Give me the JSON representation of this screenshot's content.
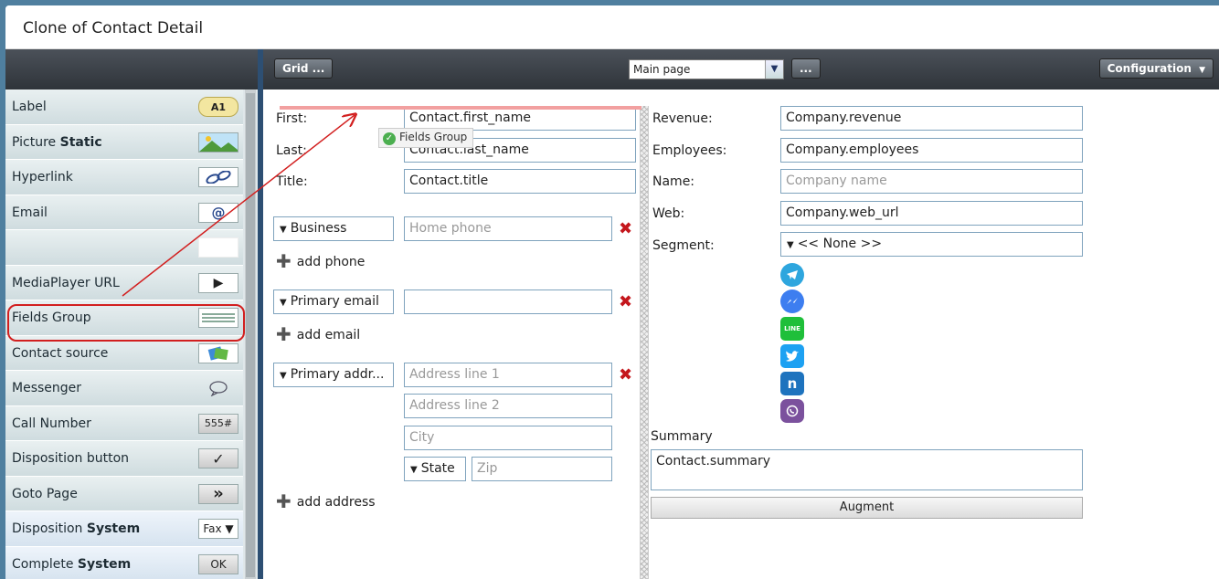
{
  "window": {
    "title": "Clone of Contact Detail"
  },
  "toolbar": {
    "grid_label": "Grid ...",
    "page_select": "Main page",
    "more_label": "...",
    "configuration_label": "Configuration"
  },
  "sidebar": {
    "items": [
      {
        "label": "Label",
        "bold": "",
        "icon": "A1"
      },
      {
        "label": "Picture ",
        "bold": "Static",
        "icon": "picture-icon"
      },
      {
        "label": "Hyperlink",
        "bold": "",
        "icon": "link-icon"
      },
      {
        "label": "Email",
        "bold": "",
        "icon": "@"
      },
      {
        "label": "",
        "bold": "",
        "icon": ""
      },
      {
        "label": "MediaPlayer URL",
        "bold": "",
        "icon": "▶"
      },
      {
        "label": "Fields Group",
        "bold": "",
        "icon": "fields-group-icon"
      },
      {
        "label": "Contact source",
        "bold": "",
        "icon": "contact-source-icon"
      },
      {
        "label": "Messenger",
        "bold": "",
        "icon": "speech-bubble-icon"
      },
      {
        "label": "Call Number",
        "bold": "",
        "icon": "555#"
      },
      {
        "label": "Disposition button",
        "bold": "",
        "icon": "✓"
      },
      {
        "label": "Goto Page",
        "bold": "",
        "icon": "»"
      },
      {
        "label": "Disposition ",
        "bold": "System",
        "icon": "Fax ▼"
      },
      {
        "label": "Complete ",
        "bold": "System",
        "icon": "OK"
      }
    ]
  },
  "drag_tooltip": "Fields Group",
  "left_form": {
    "first_label": "First:",
    "first_value": "Contact.first_name",
    "last_label": "Last:",
    "last_value": "Contact.last_name",
    "title_label": "Title:",
    "title_value": "Contact.title",
    "phone_type": "Business",
    "phone_placeholder": "Home phone",
    "add_phone": "add phone",
    "email_type": "Primary email",
    "email_value": "",
    "add_email": "add email",
    "address_type": "Primary addr...",
    "address1_placeholder": "Address line 1",
    "address2_placeholder": "Address line 2",
    "city_placeholder": "City",
    "state_label": "State",
    "zip_placeholder": "Zip",
    "add_address": "add address"
  },
  "right_form": {
    "revenue_label": "Revenue:",
    "revenue_value": "Company.revenue",
    "employees_label": "Employees:",
    "employees_value": "Company.employees",
    "name_label": "Name:",
    "name_placeholder": "Company name",
    "web_label": "Web:",
    "web_value": "Company.web_url",
    "segment_label": "Segment:",
    "segment_value": "<< None >>",
    "messengers": [
      "telegram-icon",
      "messenger-icon",
      "line-icon",
      "twitter-icon",
      "nextiva-icon",
      "viber-icon"
    ],
    "summary_label": "Summary",
    "summary_value": "Contact.summary",
    "augment_label": "Augment"
  },
  "colors": {
    "accent_red": "#d21f1f",
    "toolbar_dark": "#2f343a",
    "field_border": "#7fa3bd"
  }
}
